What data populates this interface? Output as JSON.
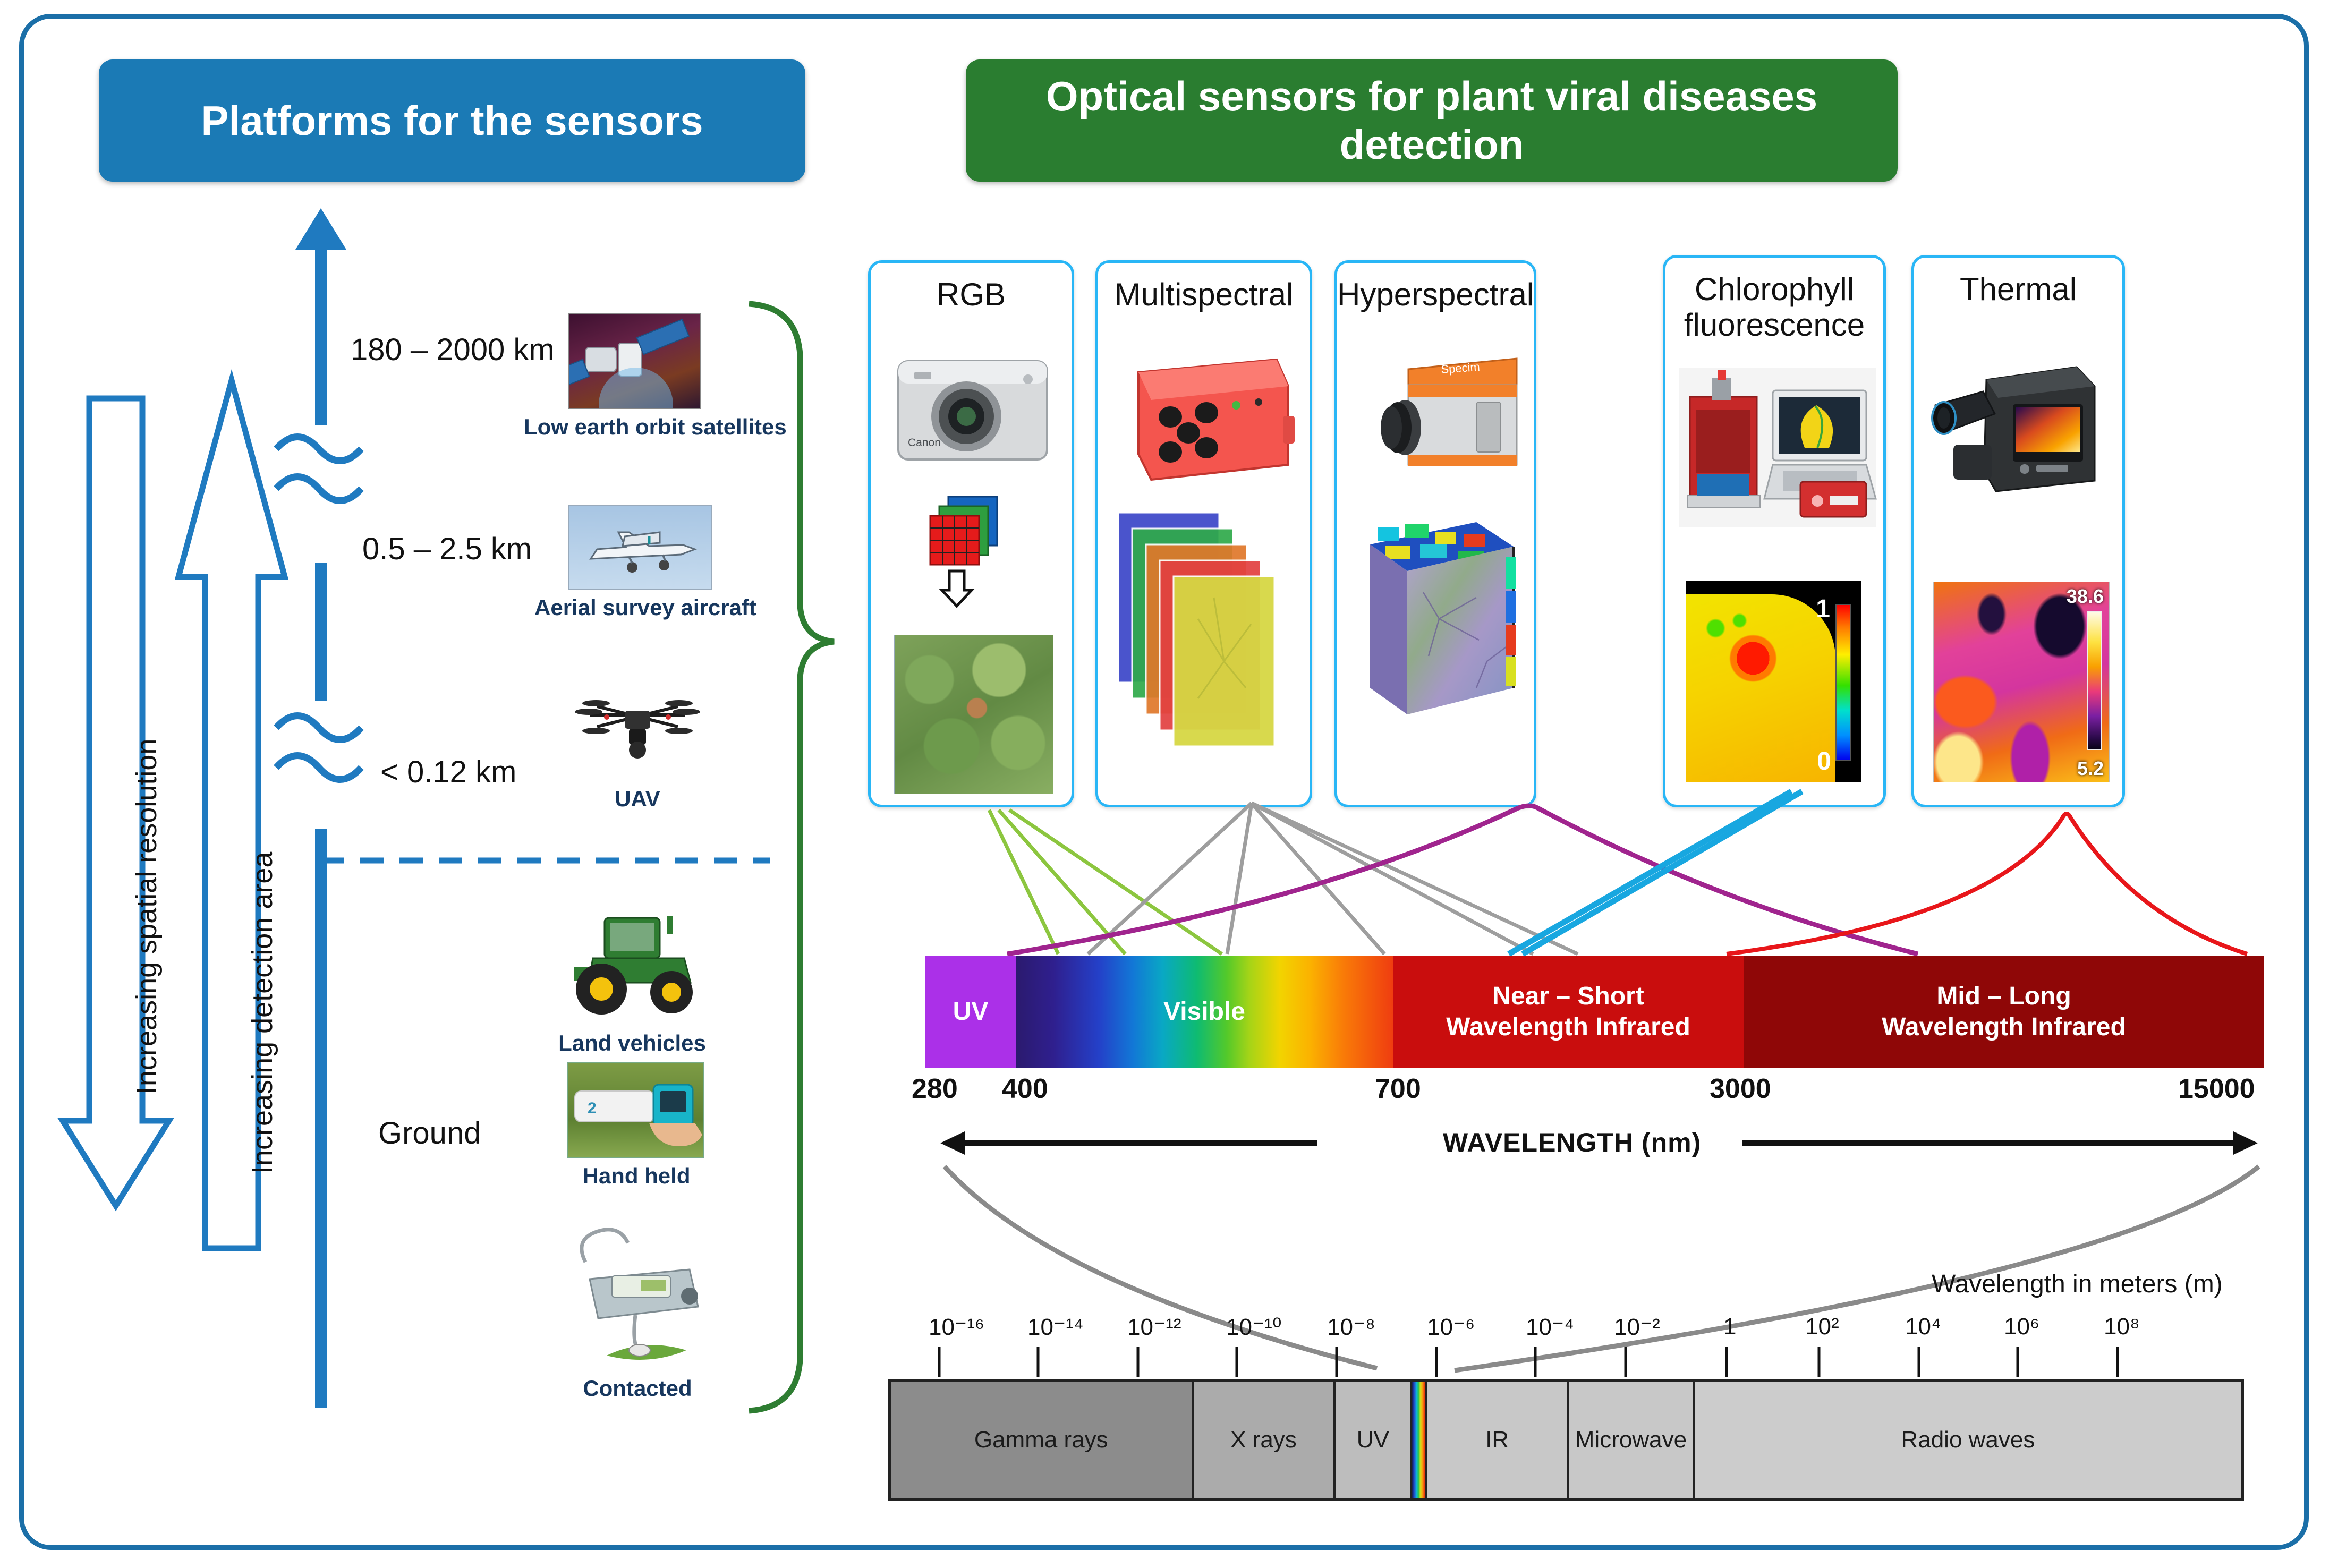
{
  "headers": {
    "left": "Platforms for the sensors",
    "right": "Optical sensors for plant viral diseases detection"
  },
  "axes": {
    "spatial_resolution": "Increasing spatial resolution",
    "detection_area": "Increasing detection area"
  },
  "platforms": [
    {
      "altitude": "180 – 2000 km",
      "caption": "Low earth orbit satellites",
      "icon": "satellite-icon"
    },
    {
      "altitude": "0.5 – 2.5 km",
      "caption": "Aerial survey aircraft",
      "icon": "aircraft-icon"
    },
    {
      "altitude": "< 0.12 km",
      "caption": "UAV",
      "icon": "drone-icon"
    },
    {
      "altitude": "Ground",
      "caption": "Land vehicles",
      "icon": "tractor-icon"
    },
    {
      "altitude": "",
      "caption": "Hand held",
      "icon": "handheld-sensor-icon"
    },
    {
      "altitude": "",
      "caption": "Contacted",
      "icon": "contact-sensor-icon"
    }
  ],
  "ground_label": "Ground",
  "sensors": [
    {
      "title": "RGB",
      "sub": "",
      "device": "compact-camera-icon",
      "sample": "rgb-leaf-image",
      "legend": null
    },
    {
      "title": "Multispectral",
      "sub": "",
      "device": "multispectral-camera-icon",
      "sample": "multispectral-stack-image",
      "legend": null
    },
    {
      "title": "Hyperspectral",
      "sub": "",
      "device": "hyperspectral-camera-icon",
      "sample": "hyperspectral-cube-image",
      "legend": null
    },
    {
      "title": "Chlorophyll",
      "sub": "fluorescence",
      "device": "fluorescence-imager-icon",
      "sample": "fluorescence-leaf-image",
      "legend": {
        "max": "1",
        "min": "0"
      }
    },
    {
      "title": "Thermal",
      "sub": "",
      "device": "thermal-camera-icon",
      "sample": "thermal-canopy-image",
      "legend": {
        "max": "38.6",
        "min": "5.2"
      }
    }
  ],
  "chart_data": {
    "type": "bar",
    "title": "WAVELENGTH (nm)",
    "xlabel": "WAVELENGTH (nm)",
    "categories": [
      "UV",
      "Visible",
      "Near – Short Wavelength Infrared",
      "Mid – Long Wavelength Infrared"
    ],
    "band_labels": [
      {
        "line1": "UV",
        "line2": ""
      },
      {
        "line1": "Visible",
        "line2": ""
      },
      {
        "line1": "Near – Short",
        "line2": "Wavelength Infrared"
      },
      {
        "line1": "Mid – Long",
        "line2": "Wavelength Infrared"
      }
    ],
    "tick_labels": [
      "280",
      "400",
      "700",
      "3000",
      "15000"
    ],
    "tick_values": [
      280,
      400,
      700,
      3000,
      15000
    ],
    "band_ranges": [
      [
        280,
        400
      ],
      [
        400,
        700
      ],
      [
        700,
        3000
      ],
      [
        3000,
        15000
      ]
    ],
    "band_colors": [
      "#ab30e8",
      "rainbow-gradient",
      "#c90d0d",
      "#8f0707"
    ],
    "units": "nm",
    "grid": false
  },
  "em_spectrum": {
    "caption": "Wavelength in meters (m)",
    "bands": [
      {
        "label": "Gamma rays",
        "color": "#8c8c8c"
      },
      {
        "label": "X rays",
        "color": "#ababab"
      },
      {
        "label": "UV",
        "color": "#bdbdbd"
      },
      {
        "label": "",
        "color": "visible-rainbow"
      },
      {
        "label": "IR",
        "color": "#c8c8c8"
      },
      {
        "label": "Microwave",
        "color": "#c8c8c8"
      },
      {
        "label": "Radio waves",
        "color": "#cccccc"
      }
    ],
    "ticks": [
      "10⁻¹⁶",
      "10⁻¹⁴",
      "10⁻¹²",
      "10⁻¹⁰",
      "10⁻⁸",
      "10⁻⁶",
      "10⁻⁴",
      "10⁻²",
      "1",
      "10²",
      "10⁴",
      "10⁶",
      "10⁸"
    ]
  },
  "colors": {
    "frame_border": "#1b6fa8",
    "header_left": "#1b7ab5",
    "header_right": "#2a7d30",
    "sensor_box_border": "#29b6f6",
    "arrow_blue": "#1f7ac0",
    "brace_green": "#2e7d32",
    "link_rgb": "#8cc63f",
    "link_multispectral": "#9e9e9e",
    "link_hyperspectral": "#a0248e",
    "link_fluorescence": "#18a7e0",
    "link_thermal": "#e8161a"
  }
}
